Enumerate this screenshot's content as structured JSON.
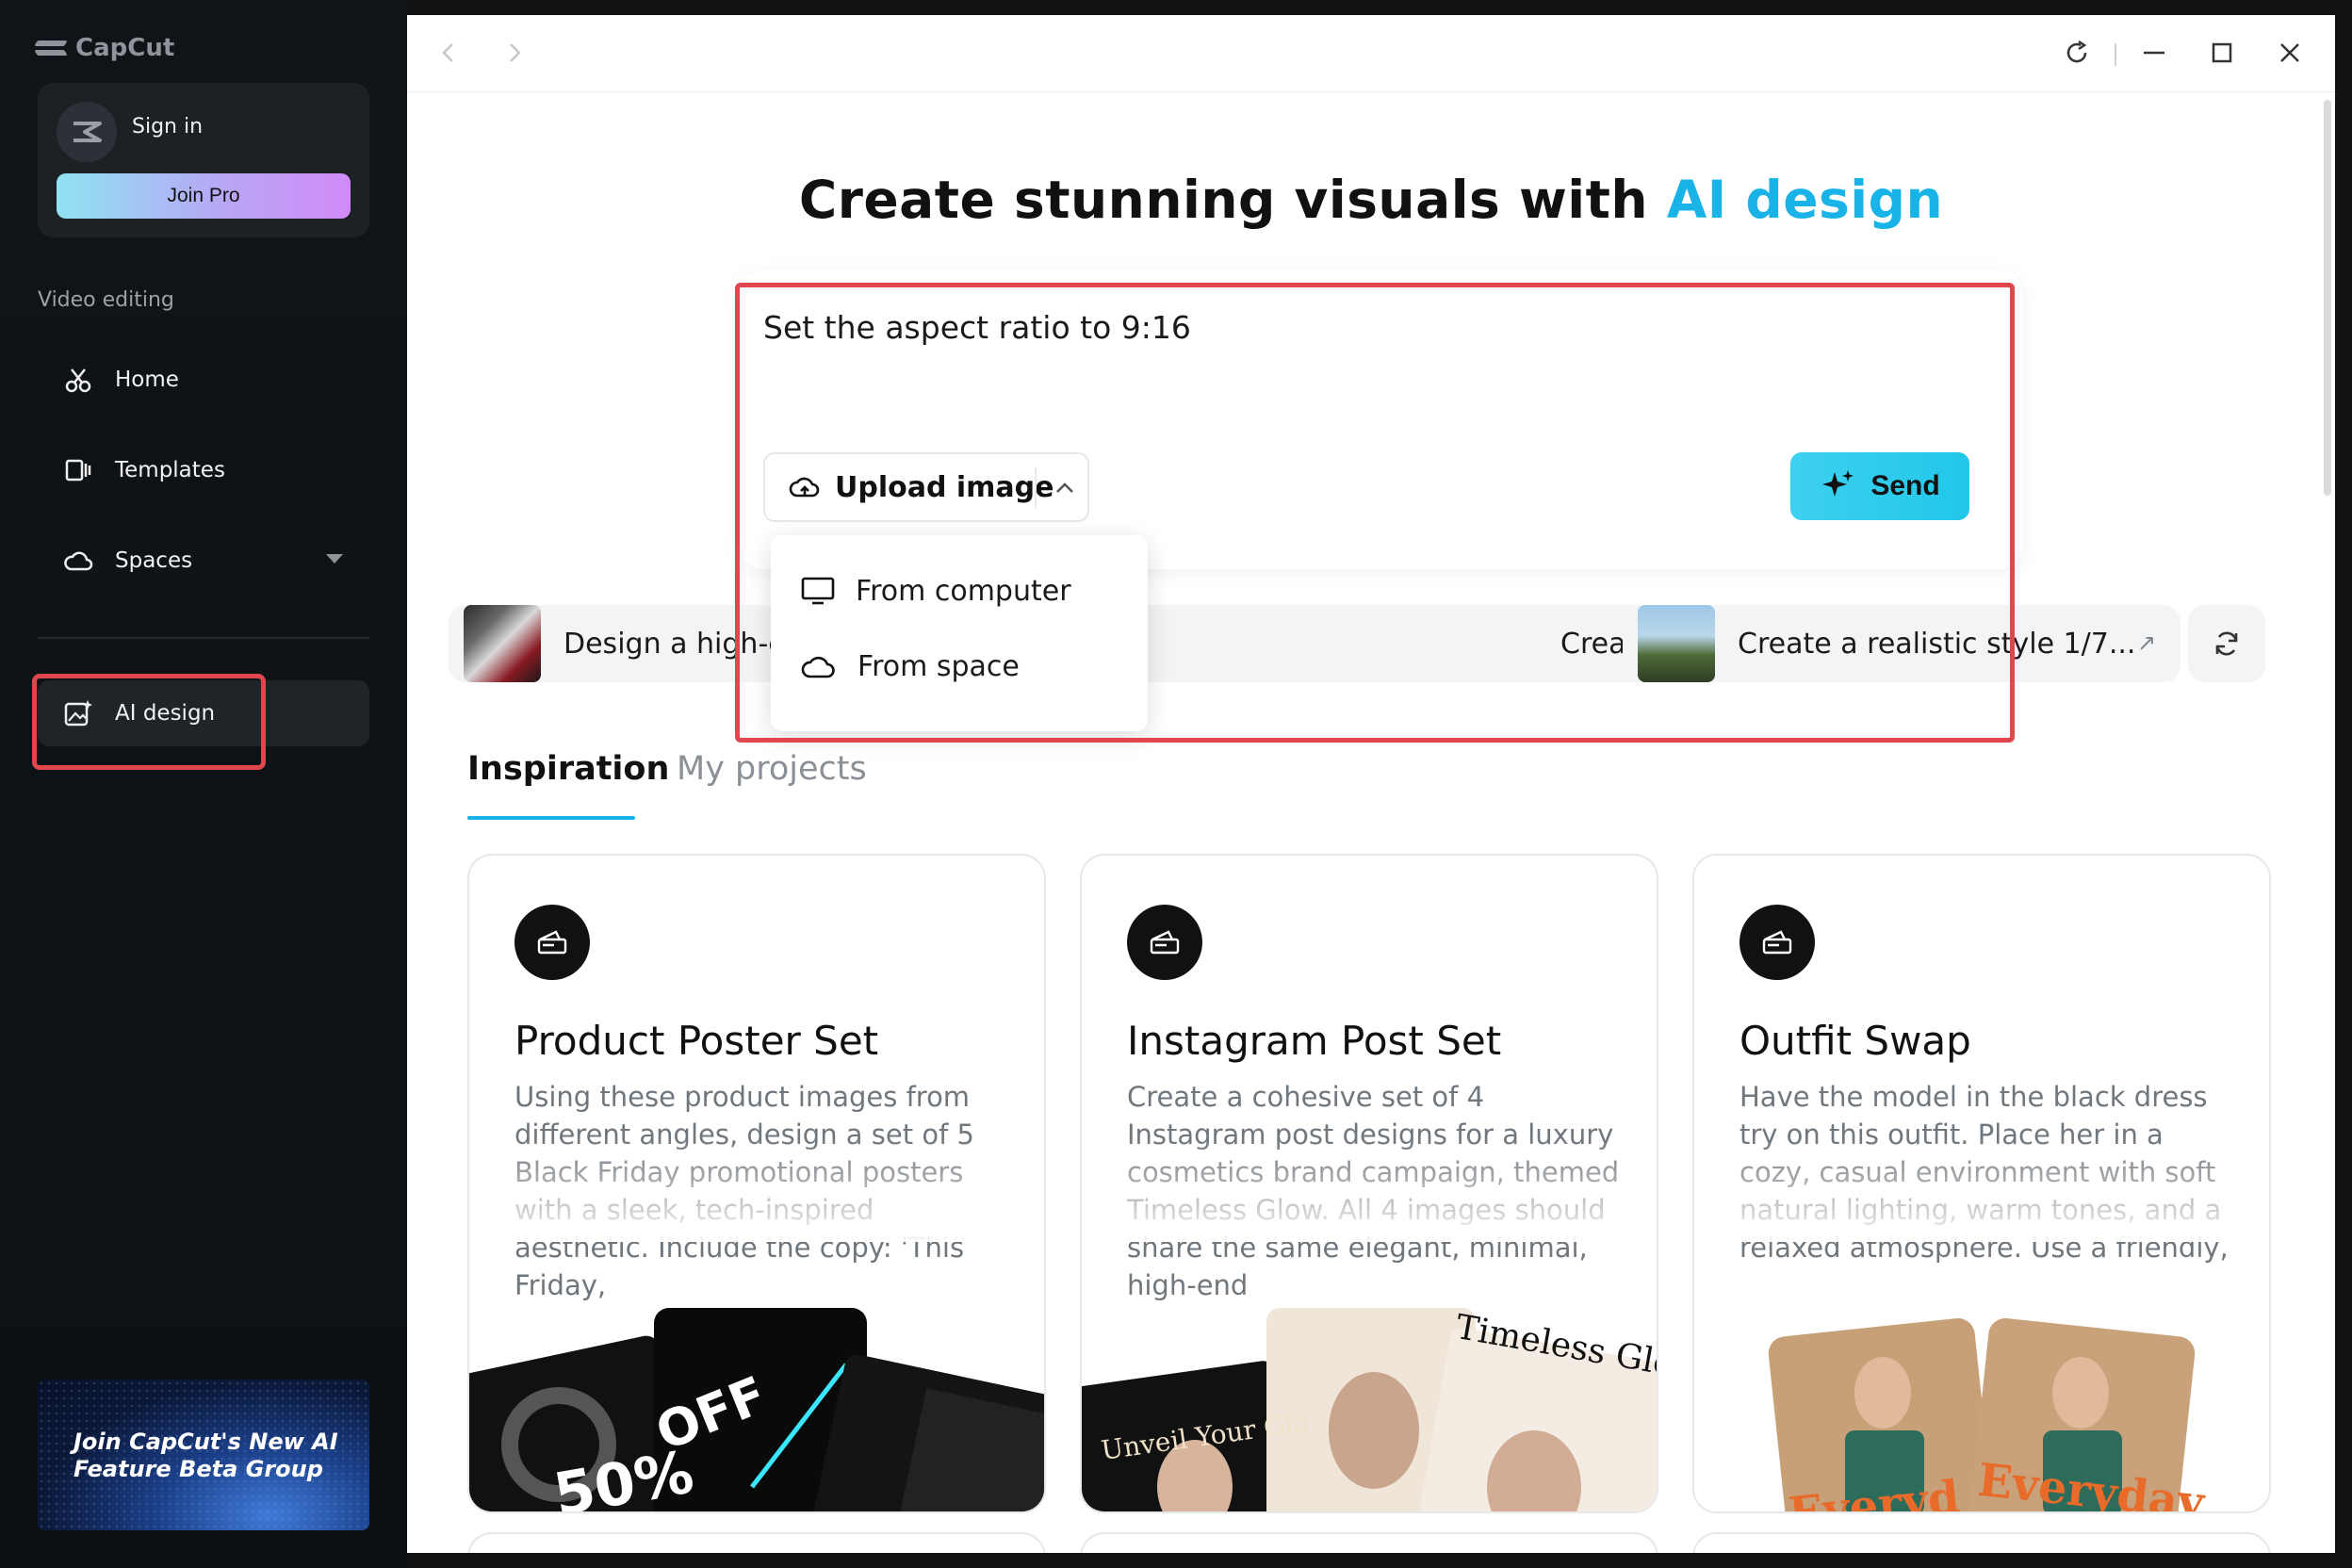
{
  "brand": {
    "name": "CapCut"
  },
  "account": {
    "signin_label": "Sign in",
    "joinpro_label": "Join Pro"
  },
  "sidebar": {
    "section_label": "Video editing",
    "items": [
      {
        "label": "Home",
        "icon": "scissors-icon"
      },
      {
        "label": "Templates",
        "icon": "templates-icon"
      },
      {
        "label": "Spaces",
        "icon": "cloud-icon"
      },
      {
        "label": "AI design",
        "icon": "ai-image-icon"
      }
    ],
    "promo_text": "Join CapCut's New AI Feature Beta Group"
  },
  "main": {
    "headline_prefix": "Create stunning visuals with ",
    "headline_accent": "AI design",
    "prompt_text": "Set the aspect ratio to 9:16",
    "upload_label": "Upload image",
    "send_label": "Send",
    "dropdown": [
      {
        "label": "From computer",
        "icon": "monitor-icon"
      },
      {
        "label": "From space",
        "icon": "cloud-icon"
      }
    ],
    "suggestions": [
      {
        "text": "Design a high-er"
      },
      {
        "text": "Create a YouTube thumbnail..."
      },
      {
        "text": "Create a realistic style 1/7..."
      }
    ],
    "tabs": [
      {
        "label": "Inspiration",
        "active": true
      },
      {
        "label": "My projects",
        "active": false
      }
    ],
    "cards": [
      {
        "title": "Product Poster Set",
        "desc": "Using these product images from different angles, design a set of 5 Black Friday promotional posters with a sleek, tech-inspired aesthetic. Include the copy: 'This Friday,",
        "art_text_1": "50%",
        "art_text_2": "OFF"
      },
      {
        "title": "Instagram Post Set",
        "desc": "Create a cohesive set of 4 Instagram post designs for a luxury cosmetics brand campaign, themed Timeless Glow. All 4 images should share the same elegant, minimal, high-end",
        "art_text_1": "Unveil Your Glo",
        "art_text_2": "Timeless Glow"
      },
      {
        "title": "Outfit Swap",
        "desc": "Have the model in the black dress try on this outfit. Place her in a cozy, casual environment with soft natural lighting, warm tones, and a relaxed atmosphere. Use a friendly,",
        "art_text_1": "Everyd",
        "art_text_2": "Everyday"
      }
    ]
  },
  "colors": {
    "accent": "#1ab3e8",
    "highlight_box": "#e0474d",
    "send_bg": "#2ccbec"
  }
}
